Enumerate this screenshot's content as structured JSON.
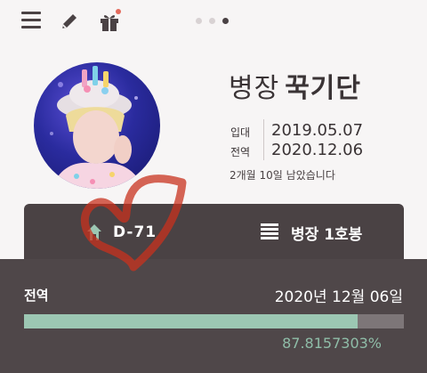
{
  "header": {
    "menu_icon": "hamburger-icon",
    "edit_icon": "pencil-icon",
    "gift_icon": "gift-icon",
    "page_indicator": {
      "count": 3,
      "active_index": 2
    }
  },
  "profile": {
    "rank": "병장",
    "name": "꾹기단",
    "enlist_label": "입대",
    "enlist_date": "2019.05.07",
    "discharge_label": "전역",
    "discharge_date": "2020.12.06",
    "remaining_text": "2개월 10일 남았습니다"
  },
  "summary": {
    "dday_icon": "house-icon",
    "dday": "D-71",
    "rank_icon": "list-icon",
    "rank_step": "병장 1호봉"
  },
  "progress": {
    "label": "전역",
    "date": "2020년 12월 06일",
    "percent_text": "87.8157303%",
    "fraction": 0.878157303
  },
  "colors": {
    "dark_card": "#4a4244",
    "bar_fill": "#9cc7b3",
    "bar_track": "#7d7678",
    "doodle": "#c8321e"
  }
}
